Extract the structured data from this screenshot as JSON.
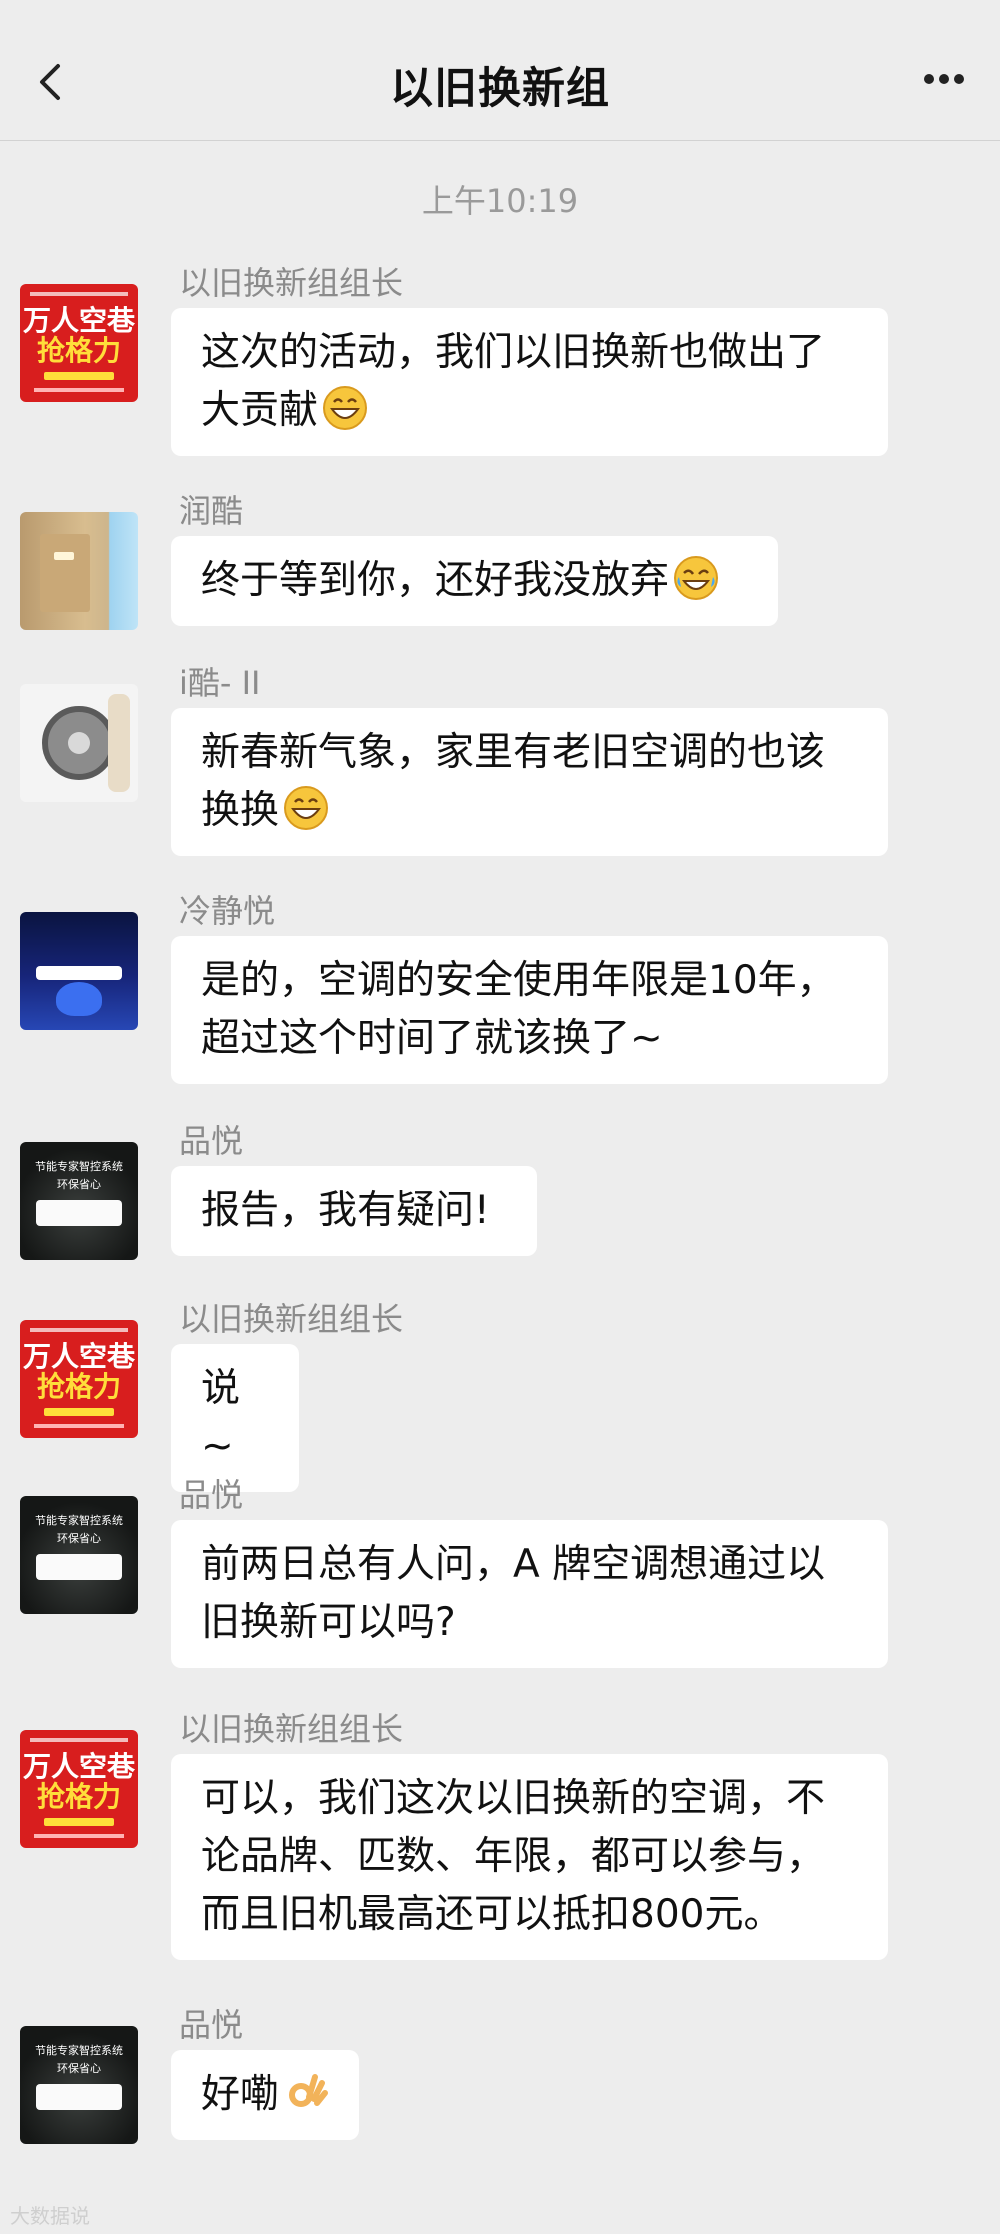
{
  "header": {
    "title": "以旧换新组",
    "back_icon": "chevron-left-icon",
    "more_icon": "more-dots-icon"
  },
  "timestamp": "上午10:19",
  "avatars": {
    "red": {
      "line1": "万人空巷",
      "line2": "抢格力"
    }
  },
  "messages": [
    {
      "sender": "以旧换新组组长",
      "lines": [
        "这次的活动，我们以旧换新也做出了",
        "大贡献"
      ],
      "emoji": "grinning-emoji"
    },
    {
      "sender": "润酷",
      "lines": [
        "终于等到你，还好我没放弃"
      ],
      "emoji": "tears-of-joy-emoji"
    },
    {
      "sender": "i酷- II",
      "lines": [
        "新春新气象，家里有老旧空调的也该",
        "换换"
      ],
      "emoji": "grinning-emoji"
    },
    {
      "sender": "冷静悦",
      "lines": [
        "是的，空调的安全使用年限是10年，",
        "超过这个时间了就该换了~"
      ]
    },
    {
      "sender": "品悦",
      "lines": [
        "报告，我有疑问!"
      ]
    },
    {
      "sender": "以旧换新组组长",
      "lines": [
        "说~"
      ]
    },
    {
      "sender": "品悦",
      "lines": [
        "前两日总有人问，A 牌空调想通过以",
        "旧换新可以吗?"
      ]
    },
    {
      "sender": "以旧换新组组长",
      "lines": [
        "可以，我们这次以旧换新的空调，不",
        "论品牌、匹数、年限，都可以参与，",
        "而且旧机最高还可以抵扣800元。"
      ]
    },
    {
      "sender": "品悦",
      "lines": [
        "好嘞"
      ],
      "emoji": "ok-hand-emoji"
    }
  ],
  "dark_avatar": {
    "line1": "节能专家智控系统",
    "line2": "环保省心"
  },
  "watermark": "大数据说"
}
